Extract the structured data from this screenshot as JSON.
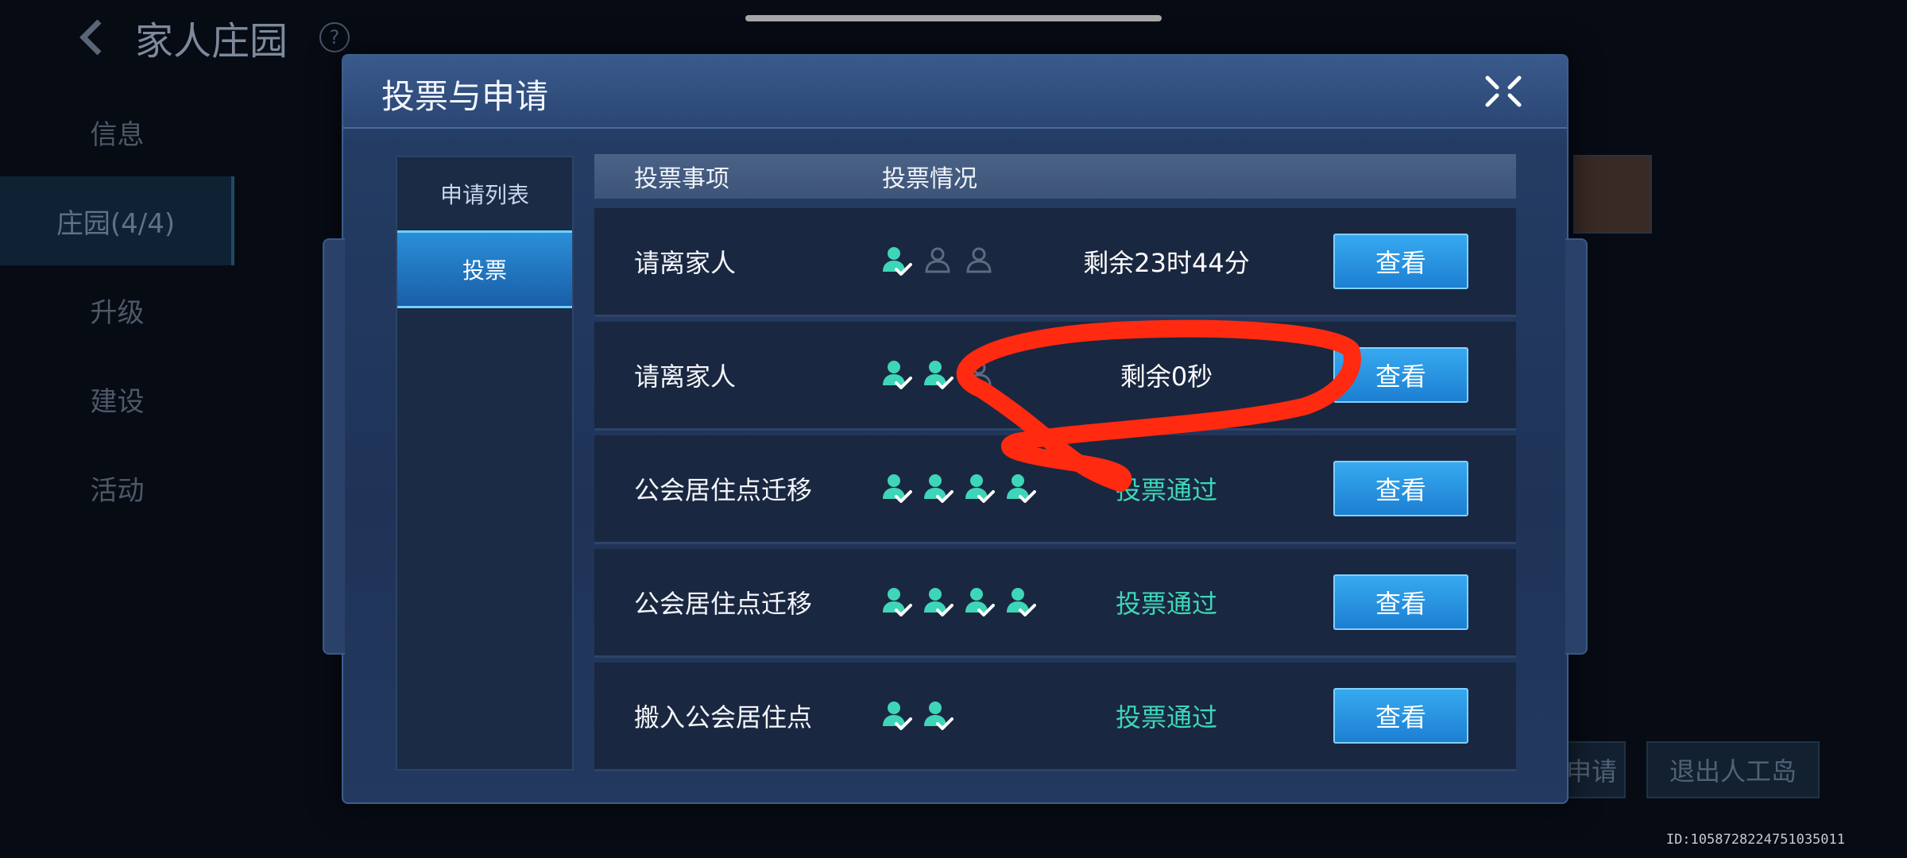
{
  "background": {
    "title": "家人庄园",
    "help": "?",
    "nav": [
      {
        "label": "信息"
      },
      {
        "label": "庄园(4/4)"
      },
      {
        "label": "升级"
      },
      {
        "label": "建设"
      },
      {
        "label": "活动"
      }
    ],
    "bottom_buttons": [
      "申请",
      "退出人工岛"
    ],
    "player_id": "ID:1058728224751035011"
  },
  "modal": {
    "title": "投票与申请",
    "tabs": [
      {
        "label": "申请列表"
      },
      {
        "label": "投票"
      }
    ],
    "columns": {
      "item": "投票事项",
      "status": "投票情况"
    },
    "rows": [
      {
        "title": "请离家人",
        "votes": [
          "yes",
          "none",
          "none"
        ],
        "status": "剩余23时44分",
        "status_type": "countdown",
        "button": "查看"
      },
      {
        "title": "请离家人",
        "votes": [
          "yes",
          "yes",
          "none"
        ],
        "status": "剩余0秒",
        "status_type": "countdown",
        "button": "查看"
      },
      {
        "title": "公会居住点迁移",
        "votes": [
          "yes",
          "yes",
          "yes",
          "yes"
        ],
        "status": "投票通过",
        "status_type": "passed",
        "button": "查看"
      },
      {
        "title": "公会居住点迁移",
        "votes": [
          "yes",
          "yes",
          "yes",
          "yes"
        ],
        "status": "投票通过",
        "status_type": "passed",
        "button": "查看"
      },
      {
        "title": "搬入公会居住点",
        "votes": [
          "yes",
          "yes"
        ],
        "status": "投票通过",
        "status_type": "passed",
        "button": "查看"
      }
    ]
  },
  "colors": {
    "accent": "#1d7fd2",
    "vote_yes": "#3ed6b8",
    "vote_none": "#5c6b80",
    "annotation": "#ff2a10"
  }
}
